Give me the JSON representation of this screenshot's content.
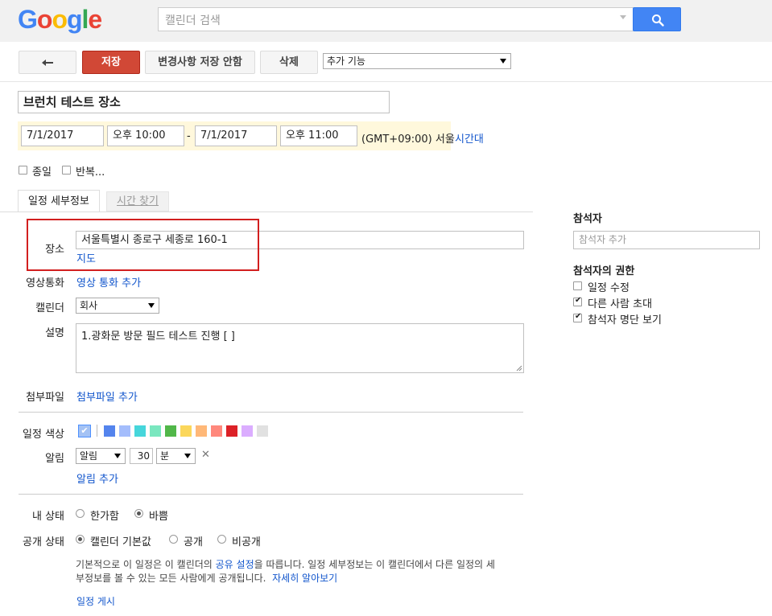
{
  "header": {
    "logo_letters": [
      "G",
      "o",
      "o",
      "g",
      "l",
      "e"
    ],
    "search_placeholder": "캘린더 검색"
  },
  "toolbar": {
    "back_label": "←",
    "save_label": "저장",
    "discard_label": "변경사항 저장 안함",
    "delete_label": "삭제",
    "more_actions_label": "추가 기능"
  },
  "event": {
    "title": "브런치 테스트 장소",
    "start_date": "7/1/2017",
    "start_time": "오후 10:00",
    "dash": "-",
    "end_date": "7/1/2017",
    "end_time": "오후 11:00",
    "timezone_text": "(GMT+09:00) 서울",
    "timezone_link": "시간대",
    "all_day_label": "종일",
    "repeat_label": "반복..."
  },
  "tabs": [
    {
      "label": "일정 세부정보",
      "active": true
    },
    {
      "label": "시간 찾기",
      "active": false
    }
  ],
  "details": {
    "location_label": "장소",
    "location_value": "서울특별시 종로구 세종로 160-1",
    "map_link": "지도",
    "video_label": "영상통화",
    "video_link": "영상 통화 추가",
    "calendar_label": "캘린더",
    "calendar_value": "회사",
    "description_label": "설명",
    "description_value": "1.광화문 방문 필드 테스트 진행 [  ]",
    "attachment_label": "첨부파일",
    "attachment_link": "첨부파일 추가",
    "color_label": "일정 색상",
    "colors": [
      "#5484ed",
      "#a4bdfc",
      "#46d6db",
      "#7ae7bf",
      "#51b749",
      "#fbd75b",
      "#ffb878",
      "#ff887c",
      "#dc2127",
      "#dbadff",
      "#e1e1e1"
    ],
    "reminder_label": "알림",
    "reminder_type": "알림",
    "reminder_amount": "30",
    "reminder_unit": "분",
    "reminder_remove": "✕",
    "add_reminder_link": "알림 추가",
    "status_label": "내 상태",
    "status_free": "한가함",
    "status_busy": "바쁨",
    "visibility_label": "공개 상태",
    "visibility_default": "캘린더 기본값",
    "visibility_public": "공개",
    "visibility_private": "비공개",
    "visibility_note_1": "기본적으로 이 일정은 이 캘린더의 ",
    "visibility_note_link": "공유 설정",
    "visibility_note_2": "을 따릅니다. 일정 세부정보는 이 캘린더에서 다른 일정의 세",
    "visibility_note_3": "부정보를 볼 수 있는 모든 사람에게 공개됩니다.",
    "learn_more_link": "자세히 알아보기",
    "publish_link": "일정 게시"
  },
  "guests": {
    "title": "참석자",
    "add_placeholder": "참석자 추가",
    "permissions_title": "참석자의 권한",
    "perm_modify": "일정 수정",
    "perm_invite": "다른 사람 초대",
    "perm_see_list": "참석자 명단 보기"
  }
}
